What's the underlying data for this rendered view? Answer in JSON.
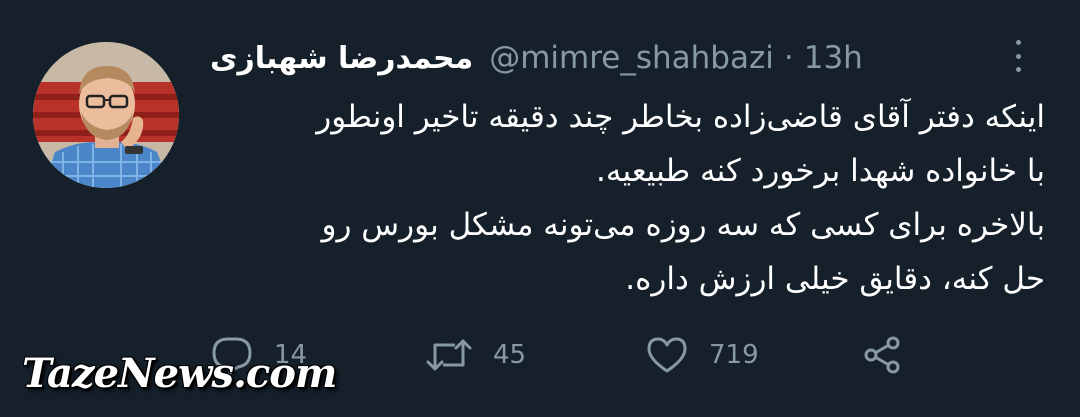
{
  "tweet": {
    "display_name": "محمدرضا شهبازی",
    "handle": "@mimre_shahbazi",
    "separator": "·",
    "time": "13h",
    "body_lines": [
      "اینکه دفتر آقای قاضی‌زاده بخاطر چند دقیقه تاخیر اونطور",
      "با خانواده شهدا برخورد کنه طبیعیه.",
      "بالاخره برای کسی که سه روزه می‌تونه مشکل بورس رو",
      "حل کنه، دقایق خیلی ارزش داره."
    ],
    "reply_count": "14",
    "retweet_count": "45",
    "like_count": "719"
  },
  "icons": {
    "more": "more-vertical-icon",
    "reply": "reply-icon",
    "retweet": "retweet-icon",
    "like": "heart-icon",
    "share": "share-icon"
  },
  "colors": {
    "background": "#15202b",
    "text": "#ffffff",
    "muted": "#8899a6"
  },
  "watermark": "TazeNews.com"
}
